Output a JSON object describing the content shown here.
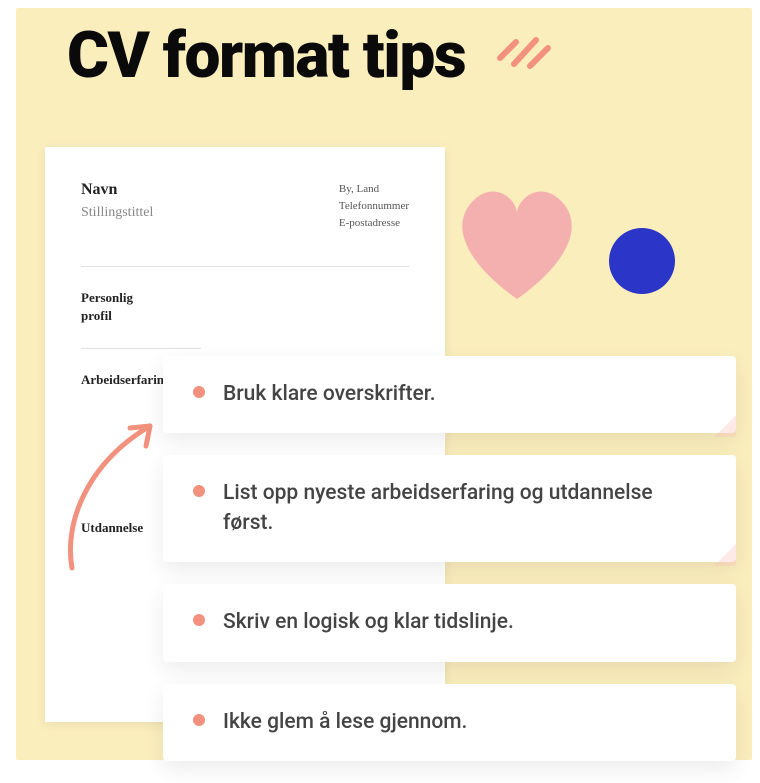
{
  "page_title": "CV format tips",
  "cv": {
    "name_label": "Navn",
    "job_label": "Stillingstittel",
    "contact": {
      "city": "By, Land",
      "phone": "Telefonnummer",
      "email": "E-postadresse"
    },
    "section_profile_line1": "Personlig",
    "section_profile_line2": "profil",
    "section_experience": "Arbeidserfaring",
    "section_education": "Utdannelse"
  },
  "tips": {
    "t1": "Bruk klare overskrifter.",
    "t2": "List opp nyeste arbeidserfaring og utdannelse først.",
    "t3": "Skriv en logisk og klar tidslinje.",
    "t4": "Ikke glem å lese gjennom."
  },
  "colors": {
    "canvas": "#fbeebd",
    "accent": "#f1917e",
    "blue": "#2b35c7",
    "pink": "#f4b0ae"
  }
}
